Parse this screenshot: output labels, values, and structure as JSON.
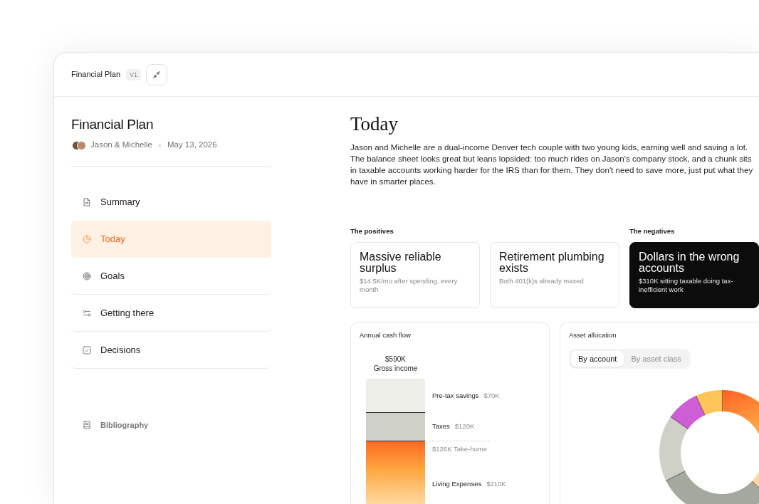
{
  "window": {
    "title": "Financial Plan",
    "version": "V1"
  },
  "sidebar": {
    "title": "Financial Plan",
    "clients": "Jason & Michelle",
    "date": "May 13, 2026",
    "items": [
      {
        "label": "Summary",
        "selected": false
      },
      {
        "label": "Today",
        "selected": true
      },
      {
        "label": "Goals",
        "selected": false
      },
      {
        "label": "Getting there",
        "selected": false
      },
      {
        "label": "Decisions",
        "selected": false
      }
    ],
    "footer_link": "Bibliography"
  },
  "main": {
    "title": "Today",
    "intro": "Jason and Michelle are a dual-income Denver tech couple with two young kids, earning well and saving a lot. The balance sheet looks great but leans lopsided: too much rides on Jason's company stock, and a chunk sits in taxable accounts working harder for the IRS than for them. They don't need to save more, just put what they have in smarter places.",
    "highlights": [
      {
        "heading": "The positives",
        "kind": "positive",
        "cards": [
          {
            "title": "Massive reliable surplus",
            "detail": "$14.5K/mo after spending, every month"
          },
          {
            "title": "Retirement plumbing exists",
            "detail": "Both 401(k)s already maxed"
          }
        ]
      },
      {
        "heading": "The negatives",
        "kind": "negative",
        "cards": [
          {
            "title": "Dollars in the wrong accounts",
            "detail": "$310K sitting taxable doing tax-inefficient work"
          }
        ]
      }
    ],
    "cash_flow": {
      "title": "Annual cash flow",
      "total": "$590K",
      "total_label": "Gross income",
      "segments": [
        {
          "label": "Pre-tax savings",
          "amount": "$70K",
          "color": "#eeeee8",
          "kind": "solid"
        },
        {
          "label": "Taxes",
          "amount": "$120K",
          "color": "#cfd1c8",
          "kind": "solid"
        },
        {
          "label": "Living Expenses",
          "amount": "$210K",
          "color": "#ff6a24",
          "kind": "gradient",
          "marker": "$126K Take-home"
        }
      ]
    },
    "asset_allocation": {
      "title": "Asset allocation",
      "tabs": [
        {
          "label": "By account",
          "selected": true
        },
        {
          "label": "By asset class",
          "selected": false
        }
      ]
    }
  }
}
